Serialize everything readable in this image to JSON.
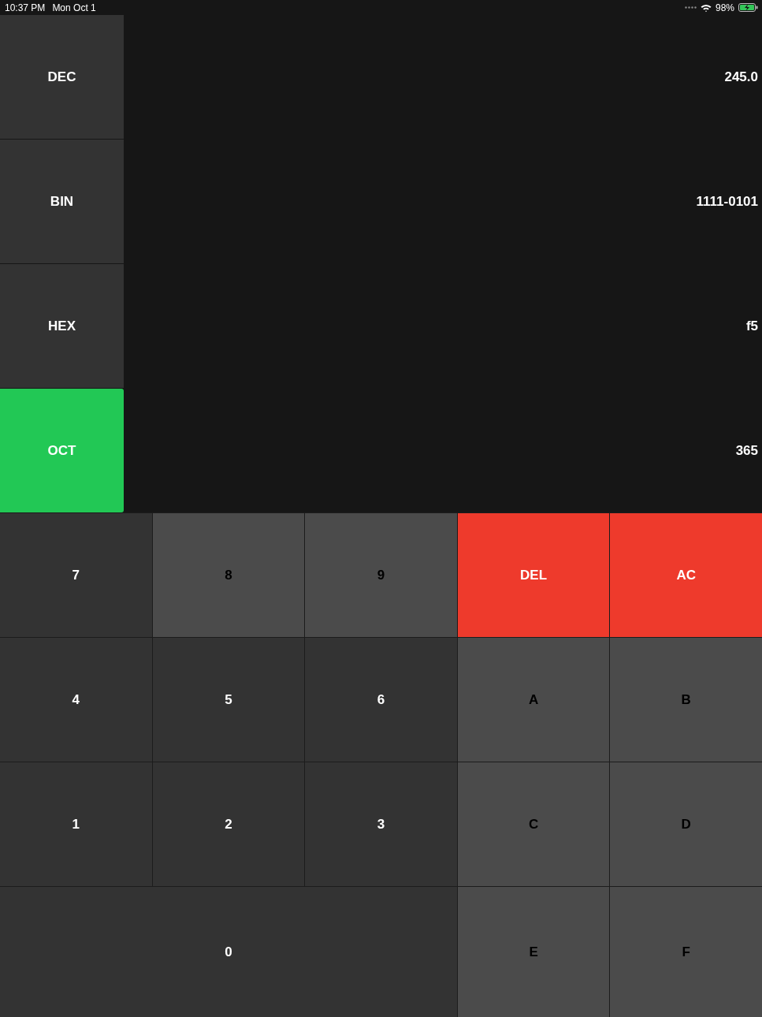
{
  "status_bar": {
    "time": "10:37 PM",
    "date": "Mon Oct 1",
    "battery": "98%",
    "charging": true
  },
  "modes": [
    {
      "label": "DEC",
      "value": "245.0",
      "selected": false
    },
    {
      "label": "BIN",
      "value": "1111-0101",
      "selected": false
    },
    {
      "label": "HEX",
      "value": "f5",
      "selected": false
    },
    {
      "label": "OCT",
      "value": "365",
      "selected": true
    }
  ],
  "keys": [
    {
      "label": "7",
      "kind": "digit",
      "disabled": false
    },
    {
      "label": "8",
      "kind": "digit",
      "disabled": true
    },
    {
      "label": "9",
      "kind": "digit",
      "disabled": true
    },
    {
      "label": "DEL",
      "kind": "action",
      "disabled": false
    },
    {
      "label": "AC",
      "kind": "action",
      "disabled": false
    },
    {
      "label": "4",
      "kind": "digit",
      "disabled": false
    },
    {
      "label": "5",
      "kind": "digit",
      "disabled": false
    },
    {
      "label": "6",
      "kind": "digit",
      "disabled": false
    },
    {
      "label": "A",
      "kind": "digit",
      "disabled": true
    },
    {
      "label": "B",
      "kind": "digit",
      "disabled": true
    },
    {
      "label": "1",
      "kind": "digit",
      "disabled": false
    },
    {
      "label": "2",
      "kind": "digit",
      "disabled": false
    },
    {
      "label": "3",
      "kind": "digit",
      "disabled": false
    },
    {
      "label": "C",
      "kind": "digit",
      "disabled": true
    },
    {
      "label": "D",
      "kind": "digit",
      "disabled": true
    },
    {
      "label": "0",
      "kind": "wide",
      "disabled": false
    },
    {
      "label": "E",
      "kind": "digit",
      "disabled": true
    },
    {
      "label": "F",
      "kind": "digit",
      "disabled": true
    }
  ]
}
